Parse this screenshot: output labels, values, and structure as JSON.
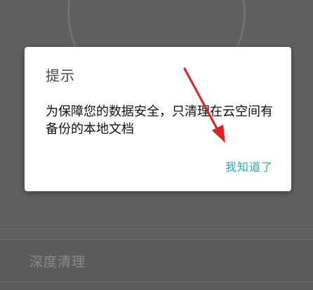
{
  "dialog": {
    "title": "提示",
    "message": "为保障您的数据安全，只清理在云空间有备份的本地文档",
    "confirm_label": "我知道了"
  },
  "background": {
    "row_label": "深度清理"
  },
  "colors": {
    "accent": "#1fb5a3",
    "annotation_arrow": "#e61e1e"
  }
}
